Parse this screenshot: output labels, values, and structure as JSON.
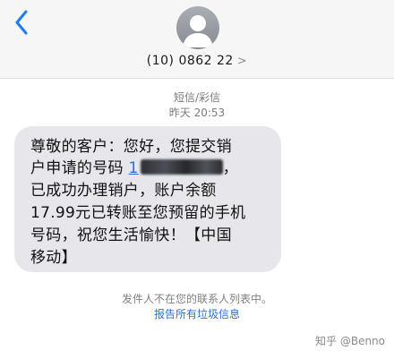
{
  "header": {
    "contact_name": "(10) 0862 22",
    "contact_chevron": ">"
  },
  "thread": {
    "service_label": "短信/彩信",
    "timestamp": "昨天 20:53"
  },
  "message": {
    "lines": [
      "尊敬的客户：您好，您提交销",
      "户申请的号码",
      "已成功办理销户，账户余额",
      "17.99元已转账至您预留的手机",
      "号码，祝您生活愉快！【中国",
      "移动】"
    ],
    "phone_prefix": "1",
    "line2_tail": "，"
  },
  "footer": {
    "notice": "发件人不在您的联系人列表中。",
    "report_link": "报告所有垃圾信息"
  },
  "watermark": "知乎 @Benno",
  "colors": {
    "link": "#2b6fd6",
    "bubble": "#e6e6eb",
    "header_bg": "#f6f6f7"
  }
}
